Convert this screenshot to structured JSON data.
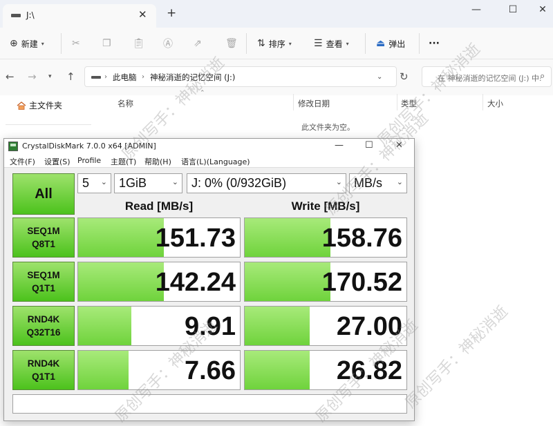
{
  "explorer": {
    "tab_title": "J:\\",
    "new_tab": "+",
    "window_controls": {
      "minimize": "—",
      "maximize": "☐",
      "close": "✕"
    },
    "toolbar": {
      "new_label": "新建",
      "sort_label": "排序",
      "view_label": "查看",
      "eject_label": "弹出",
      "more_label": "···"
    },
    "breadcrumb": [
      "此电脑",
      "神秘消逝的记忆空间 (J:)"
    ],
    "search_placeholder": "在 神秘消逝的记忆空间 (J:) 中...",
    "nav_home": "主文件夹",
    "columns": [
      "名称",
      "修改日期",
      "类型",
      "大小"
    ],
    "empty_text": "此文件夹为空。"
  },
  "cdm": {
    "title": "CrystalDiskMark 7.0.0 x64 [ADMIN]",
    "menu": [
      "文件(F)",
      "设置(S)",
      "Profile",
      "主题(T)",
      "帮助(H)",
      "语言(L)(Language)"
    ],
    "all_label": "All",
    "count": "5",
    "size": "1GiB",
    "drive": "J: 0% (0/932GiB)",
    "unit": "MB/s",
    "read_header": "Read [MB/s]",
    "write_header": "Write [MB/s]",
    "tests": [
      {
        "line1": "SEQ1M",
        "line2": "Q8T1",
        "read": "151.73",
        "write": "158.76",
        "read_level": 0.53,
        "write_level": 0.53
      },
      {
        "line1": "SEQ1M",
        "line2": "Q1T1",
        "read": "142.24",
        "write": "170.52",
        "read_level": 0.53,
        "write_level": 0.53
      },
      {
        "line1": "RND4K",
        "line2": "Q32T16",
        "read": "9.91",
        "write": "27.00",
        "read_level": 0.33,
        "write_level": 0.4
      },
      {
        "line1": "RND4K",
        "line2": "Q1T1",
        "read": "7.66",
        "write": "26.82",
        "read_level": 0.31,
        "write_level": 0.4
      }
    ],
    "comment": ""
  },
  "watermark": "原创写手：神秘消逝"
}
